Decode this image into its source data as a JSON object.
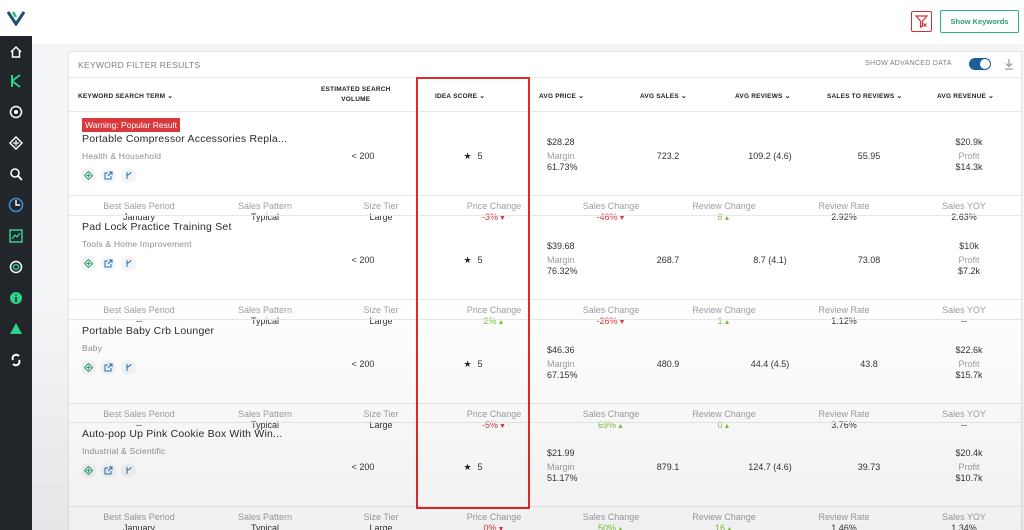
{
  "topbar": {
    "show_keywords_label": "Show Keywords"
  },
  "panel": {
    "title": "KEYWORD FILTER RESULTS",
    "advanced_label": "SHOW ADVANCED DATA"
  },
  "columns": {
    "term": "KEYWORD SEARCH TERM",
    "volume_line1": "ESTIMATED SEARCH",
    "volume_line2": "VOLUME",
    "idea": "IDEA SCORE",
    "price": "AVG PRICE",
    "sales": "AVG SALES",
    "reviews": "AVG REVIEWS",
    "str": "SALES TO REVIEWS",
    "revenue": "AVG REVENUE"
  },
  "labels": {
    "margin": "Margin",
    "profit": "Profit",
    "best_sales_period": "Best Sales Period",
    "sales_pattern": "Sales Pattern",
    "size_tier": "Size Tier",
    "price_change": "Price Change",
    "sales_change": "Sales Change",
    "review_change": "Review Change",
    "review_rate": "Review Rate",
    "sales_yoy": "Sales YOY"
  },
  "rows": [
    {
      "warning": "Warning: Popular Result",
      "title": "Portable Compressor Accessories Repla...",
      "category": "Health & Household",
      "volume": "< 200",
      "idea_score": "5",
      "price": "$28.28",
      "margin": "61.73%",
      "sales": "723.2",
      "reviews": "109.2 (4.6)",
      "str": "55.95",
      "revenue": "$20.9k",
      "profit": "$14.3k",
      "best_sales_period": "January",
      "sales_pattern": "Typical",
      "size_tier": "Large",
      "price_change": "-3%",
      "price_dir": "down",
      "sales_change": "-46%",
      "sales_dir": "down",
      "review_change": "6",
      "review_dir": "up",
      "review_rate": "2.92%",
      "sales_yoy": "2.63%"
    },
    {
      "warning": "",
      "title": "Pad Lock Practice Training Set",
      "category": "Tools & Home Improvement",
      "volume": "< 200",
      "idea_score": "5",
      "price": "$39.68",
      "margin": "76.32%",
      "sales": "268.7",
      "reviews": "8.7 (4.1)",
      "str": "73.08",
      "revenue": "$10k",
      "profit": "$7.2k",
      "best_sales_period": "--",
      "sales_pattern": "Typical",
      "size_tier": "Large",
      "price_change": "2%",
      "price_dir": "up",
      "sales_change": "-26%",
      "sales_dir": "down",
      "review_change": "1",
      "review_dir": "up",
      "review_rate": "1.12%",
      "sales_yoy": "--"
    },
    {
      "warning": "",
      "title": "Portable Baby Crb Lounger",
      "category": "Baby",
      "volume": "< 200",
      "idea_score": "5",
      "price": "$46.36",
      "margin": "67.15%",
      "sales": "480.9",
      "reviews": "44.4 (4.5)",
      "str": "43.8",
      "revenue": "$22.6k",
      "profit": "$15.7k",
      "best_sales_period": "--",
      "sales_pattern": "Typical",
      "size_tier": "Large",
      "price_change": "-5%",
      "price_dir": "down",
      "sales_change": "69%",
      "sales_dir": "up",
      "review_change": "0",
      "review_dir": "up",
      "review_rate": "3.76%",
      "sales_yoy": "--"
    },
    {
      "warning": "",
      "title": "Auto-pop Up Pink Cookie Box With Win...",
      "category": "Industrial & Scientific",
      "volume": "< 200",
      "idea_score": "5",
      "price": "$21.99",
      "margin": "51.17%",
      "sales": "879.1",
      "reviews": "124.7 (4.6)",
      "str": "39.73",
      "revenue": "$20.4k",
      "profit": "$10.7k",
      "best_sales_period": "January",
      "sales_pattern": "Typical",
      "size_tier": "Large",
      "price_change": "0%",
      "price_dir": "down",
      "sales_change": "50%",
      "sales_dir": "up",
      "review_change": "16",
      "review_dir": "up",
      "review_rate": "1.46%",
      "sales_yoy": "1.34%"
    }
  ]
}
